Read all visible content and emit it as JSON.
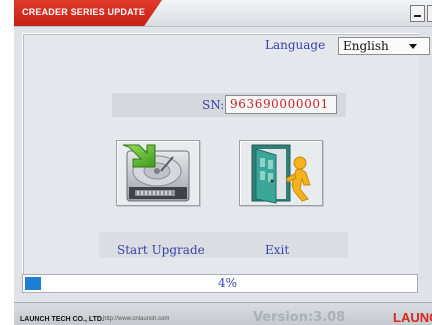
{
  "window": {
    "title": "CREADER SERIES UPDATE"
  },
  "language": {
    "label": "Language",
    "selected": "English"
  },
  "device": {
    "sn_label": "SN:",
    "sn_value": "963690000001"
  },
  "actions": {
    "start_upgrade_label": "Start Upgrade",
    "exit_label": "Exit"
  },
  "progress": {
    "percent": 4,
    "text": "4%"
  },
  "footer": {
    "company": "LAUNCH TECH CO., LTD.",
    "website": "http://www.cnlaunch.com",
    "version": "Version:3.08",
    "brand": "LAUNC"
  },
  "colors": {
    "title_red": "#d6281e",
    "label_blue": "#3a40a8",
    "sn_red": "#c8232a",
    "progress_blue": "#1e7ed6"
  },
  "icons": {
    "start_upgrade": "hard-drive-download-icon",
    "exit": "exit-door-icon"
  }
}
